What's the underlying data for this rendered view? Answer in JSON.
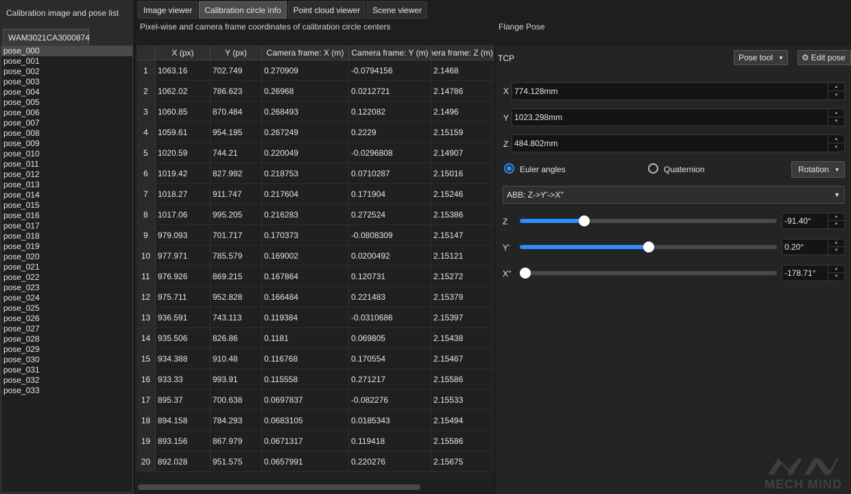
{
  "left_panel": {
    "title": "Calibration image and pose list",
    "device_tab": "WAM3021CA3000874",
    "poses": [
      "pose_000",
      "pose_001",
      "pose_002",
      "pose_003",
      "pose_004",
      "pose_005",
      "pose_006",
      "pose_007",
      "pose_008",
      "pose_009",
      "pose_010",
      "pose_011",
      "pose_012",
      "pose_013",
      "pose_014",
      "pose_015",
      "pose_016",
      "pose_017",
      "pose_018",
      "pose_019",
      "pose_020",
      "pose_021",
      "pose_022",
      "pose_023",
      "pose_024",
      "pose_025",
      "pose_026",
      "pose_027",
      "pose_028",
      "pose_029",
      "pose_030",
      "pose_031",
      "pose_032",
      "pose_033"
    ],
    "selected_index": 0
  },
  "tabs": [
    "Image viewer",
    "Calibration circle info",
    "Point cloud viewer",
    "Scene viewer"
  ],
  "active_tab": 1,
  "table_caption": "Pixel-wise and camera frame coordinates of calibration circle centers",
  "table": {
    "columns": [
      "X (px)",
      "Y (px)",
      "Camera frame: X (m)",
      "Camera frame: Y (m)",
      "Camera frame: Z (m)"
    ],
    "rows": [
      [
        "1063.16",
        "702.749",
        "0.270909",
        "-0.0794156",
        "2.1468"
      ],
      [
        "1062.02",
        "786.623",
        "0.26968",
        "0.0212721",
        "2.14786"
      ],
      [
        "1060.85",
        "870.484",
        "0.268493",
        "0.122082",
        "2.1496"
      ],
      [
        "1059.61",
        "954.195",
        "0.267249",
        "0.2229",
        "2.15159"
      ],
      [
        "1020.59",
        "744.21",
        "0.220049",
        "-0.0296808",
        "2.14907"
      ],
      [
        "1019.42",
        "827.992",
        "0.218753",
        "0.0710287",
        "2.15016"
      ],
      [
        "1018.27",
        "911.747",
        "0.217604",
        "0.171904",
        "2.15246"
      ],
      [
        "1017.06",
        "995.205",
        "0.216283",
        "0.272524",
        "2.15386"
      ],
      [
        "979.093",
        "701.717",
        "0.170373",
        "-0.0808309",
        "2.15147"
      ],
      [
        "977.971",
        "785.579",
        "0.169002",
        "0.0200492",
        "2.15121"
      ],
      [
        "976.926",
        "869.215",
        "0.167864",
        "0.120731",
        "2.15272"
      ],
      [
        "975.711",
        "952.828",
        "0.166484",
        "0.221483",
        "2.15379"
      ],
      [
        "936.591",
        "743.113",
        "0.119384",
        "-0.0310686",
        "2.15397"
      ],
      [
        "935.506",
        "826.86",
        "0.1181",
        "0.069805",
        "2.15438"
      ],
      [
        "934.388",
        "910.48",
        "0.116768",
        "0.170554",
        "2.15467"
      ],
      [
        "933.33",
        "993.91",
        "0.115558",
        "0.271217",
        "2.15586"
      ],
      [
        "895.37",
        "700.638",
        "0.0697837",
        "-0.082276",
        "2.15533"
      ],
      [
        "894.158",
        "784.293",
        "0.0683105",
        "0.0185343",
        "2.15494"
      ],
      [
        "893.156",
        "867.979",
        "0.0671317",
        "0.119418",
        "2.15586"
      ],
      [
        "892.028",
        "951.575",
        "0.0657991",
        "0.220276",
        "2.15675"
      ]
    ]
  },
  "flange": {
    "caption": "Flange Pose",
    "tcp_label": "TCP",
    "pose_tool_label": "Pose tool",
    "edit_pose_label": "Edit pose",
    "x_label": "X",
    "x_value": "774.128mm",
    "y_label": "Y",
    "y_value": "1023.298mm",
    "z_label": "Z",
    "z_value": "484.802mm",
    "euler_label": "Euler angles",
    "quaternion_label": "Quaternion",
    "rotation_label": "Rotation",
    "convention": "ABB: Z->Y'->X''",
    "sliders": [
      {
        "label": "Z",
        "value": "-91.40°",
        "fraction": 0.25
      },
      {
        "label": "Y'",
        "value": "0.20°",
        "fraction": 0.5
      },
      {
        "label": "X''",
        "value": "-178.71°",
        "fraction": 0.02
      }
    ]
  },
  "watermark": "MECH MIND",
  "colors": {
    "accent": "#2f8cff",
    "background": "#1e1e1e",
    "panel": "#2b2b2b"
  }
}
